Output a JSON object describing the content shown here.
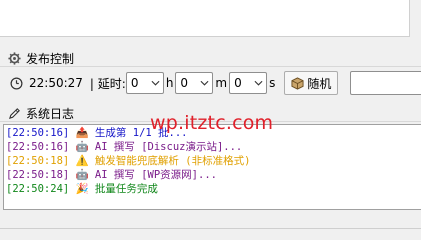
{
  "publish_control": {
    "title": "发布控制",
    "icon": "gear-icon",
    "clock_icon": "clock-icon",
    "current_time": "22:50:27",
    "delay_label": "| 延时:",
    "hours_value": "0",
    "hours_unit": "h",
    "minutes_value": "0",
    "minutes_unit": "m",
    "seconds_value": "0",
    "seconds_unit": "s",
    "random_button_label": "随机",
    "random_icon": "box-icon",
    "random_input_value": ""
  },
  "system_log": {
    "title": "系统日志",
    "icon": "pen-icon",
    "lines": [
      {
        "text": "[22:50:16] 📤 生成第 1/1 批...",
        "color": "#1515c8"
      },
      {
        "text": "[22:50:16] 🤖 AI 撰写 [Discuz演示站]...",
        "color": "#7a1c8a"
      },
      {
        "text": "[22:50:18] ⚠️  触发智能兜底解析 (非标准格式)",
        "color": "#e0a000"
      },
      {
        "text": "[22:50:18] 🤖 AI 撰写 [WP资源网]...",
        "color": "#7a1c8a"
      },
      {
        "text": "[22:50:24] 🎉 批量任务完成",
        "color": "#10871a"
      }
    ]
  },
  "watermark": "wp.itztc.com"
}
